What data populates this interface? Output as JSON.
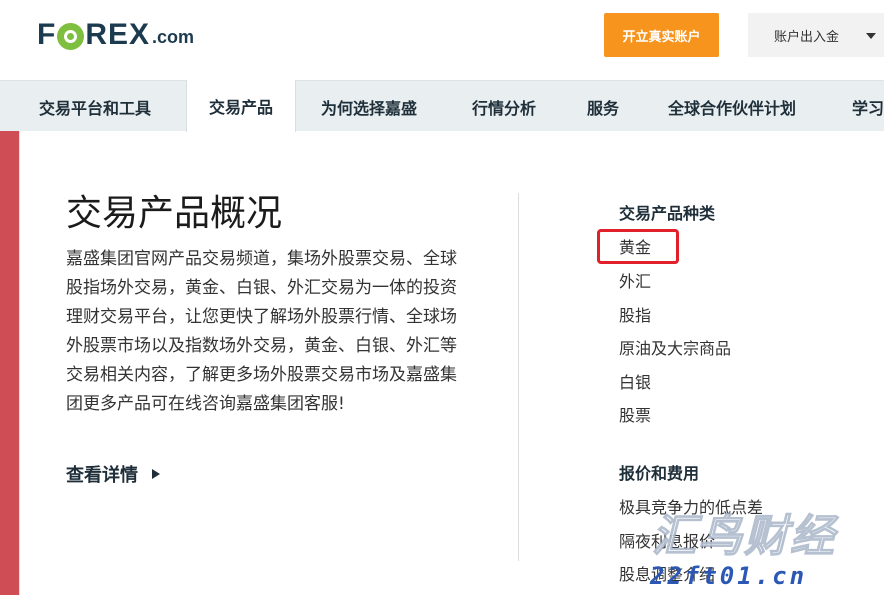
{
  "header": {
    "logo_text_left": "F",
    "logo_text_right": "REX",
    "logo_suffix": ".com",
    "open_account_label": "开立真实账户",
    "account_menu_label": "账户出入金",
    "brand_color": "#1d3b4f",
    "accent_color": "#f7941d"
  },
  "nav": {
    "items": [
      {
        "label": "交易平台和工具"
      },
      {
        "label": "交易产品"
      },
      {
        "label": "为何选择嘉盛"
      },
      {
        "label": "行情分析"
      },
      {
        "label": "服务"
      },
      {
        "label": "全球合作伙伴计划"
      },
      {
        "label": "学习"
      }
    ],
    "active_index": 1
  },
  "main": {
    "title": "交易产品概况",
    "description": "嘉盛集团官网产品交易频道，集场外股票交易、全球股指场外交易，黄金、白银、外汇交易为一体的投资理财交易平台，让您更快了解场外股票行情、全球场外股票市场以及指数场外交易，黄金、白银、外汇等交易相关内容，了解更多场外股票交易市场及嘉盛集团更多产品可在线咨询嘉盛集团客服!",
    "more_label": "查看详情"
  },
  "sidebar": {
    "section1_title": "交易产品种类",
    "section1_links": [
      "黄金",
      "外汇",
      "股指",
      "原油及大宗商品",
      "白银",
      "股票"
    ],
    "section2_title": "报价和费用",
    "section2_links": [
      "极具竞争力的低点差",
      "隔夜利息报价",
      "股息调整介绍"
    ],
    "highlight_color": "#e0202a"
  },
  "watermark": {
    "main_text": "汇鸟财经",
    "url_text": "22ft01.cn"
  }
}
